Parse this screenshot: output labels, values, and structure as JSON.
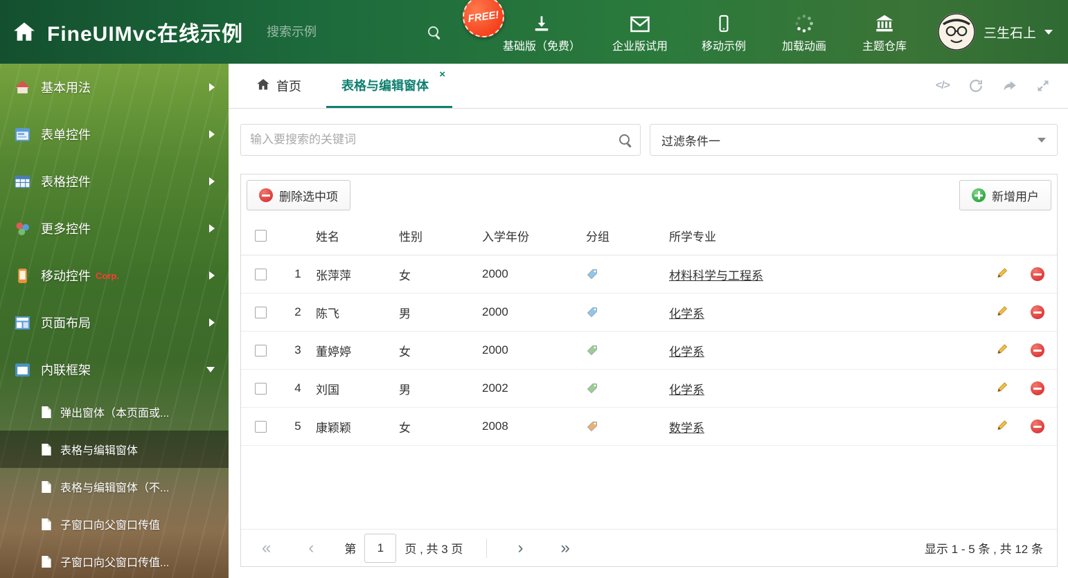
{
  "colors": {
    "header_green": "#1d6b3c",
    "accent_teal": "#0f8070",
    "danger_red": "#dd3b3b",
    "success_green": "#31a844",
    "free_badge_orange": "#f4401c",
    "corp_red": "#ff3b30",
    "tag_blue": "#8fc7ea",
    "tag_green": "#9bcf8e",
    "tag_orange": "#f0b06b"
  },
  "header": {
    "title": "FineUIMvc在线示例",
    "search_placeholder": "搜索示例",
    "free_badge": "FREE!",
    "nav": [
      {
        "label": "基础版（免费）",
        "icon": "download-icon"
      },
      {
        "label": "企业版试用",
        "icon": "mail-icon"
      },
      {
        "label": "移动示例",
        "icon": "mobile-icon"
      },
      {
        "label": "加载动画",
        "icon": "spinner-icon"
      },
      {
        "label": "主题仓库",
        "icon": "bank-icon"
      }
    ],
    "user_name": "三生石上"
  },
  "sidebar": {
    "items": [
      {
        "label": "基本用法"
      },
      {
        "label": "表单控件"
      },
      {
        "label": "表格控件"
      },
      {
        "label": "更多控件"
      },
      {
        "label": "移动控件",
        "badge": "Corp."
      },
      {
        "label": "页面布局"
      },
      {
        "label": "内联框架"
      }
    ],
    "subitems": [
      {
        "label": "弹出窗体（本页面或..."
      },
      {
        "label": "表格与编辑窗体"
      },
      {
        "label": "表格与编辑窗体（不..."
      },
      {
        "label": "子窗口向父窗口传值"
      },
      {
        "label": "子窗口向父窗口传值..."
      }
    ]
  },
  "tabs": {
    "home_label": "首页",
    "active_label": "表格与编辑窗体"
  },
  "filter": {
    "search_placeholder": "输入要搜索的关键词",
    "dropdown_value": "过滤条件一"
  },
  "toolbar": {
    "delete_label": "删除选中项",
    "add_label": "新增用户"
  },
  "table": {
    "headers": {
      "name": "姓名",
      "gender": "性别",
      "year": "入学年份",
      "group": "分组",
      "major": "所学专业"
    },
    "rows": [
      {
        "num": "1",
        "name": "张萍萍",
        "gender": "女",
        "year": "2000",
        "tag_color": "#8fc7ea",
        "major": "材料科学与工程系"
      },
      {
        "num": "2",
        "name": "陈飞",
        "gender": "男",
        "year": "2000",
        "tag_color": "#8fc7ea",
        "major": "化学系"
      },
      {
        "num": "3",
        "name": "董婷婷",
        "gender": "女",
        "year": "2000",
        "tag_color": "#9bcf8e",
        "major": "化学系"
      },
      {
        "num": "4",
        "name": "刘国",
        "gender": "男",
        "year": "2002",
        "tag_color": "#9bcf8e",
        "major": "化学系"
      },
      {
        "num": "5",
        "name": "康颖颖",
        "gender": "女",
        "year": "2008",
        "tag_color": "#f0b06b",
        "major": "数学系"
      }
    ]
  },
  "pagination": {
    "label_page": "第",
    "current_page": "1",
    "label_total": "页 , 共 3 页",
    "summary": "显示 1 - 5 条 , 共 12 条"
  },
  "icons": {
    "first": "«",
    "prev": "‹",
    "next": "›",
    "last": "»",
    "close": "×",
    "code": "</>"
  }
}
